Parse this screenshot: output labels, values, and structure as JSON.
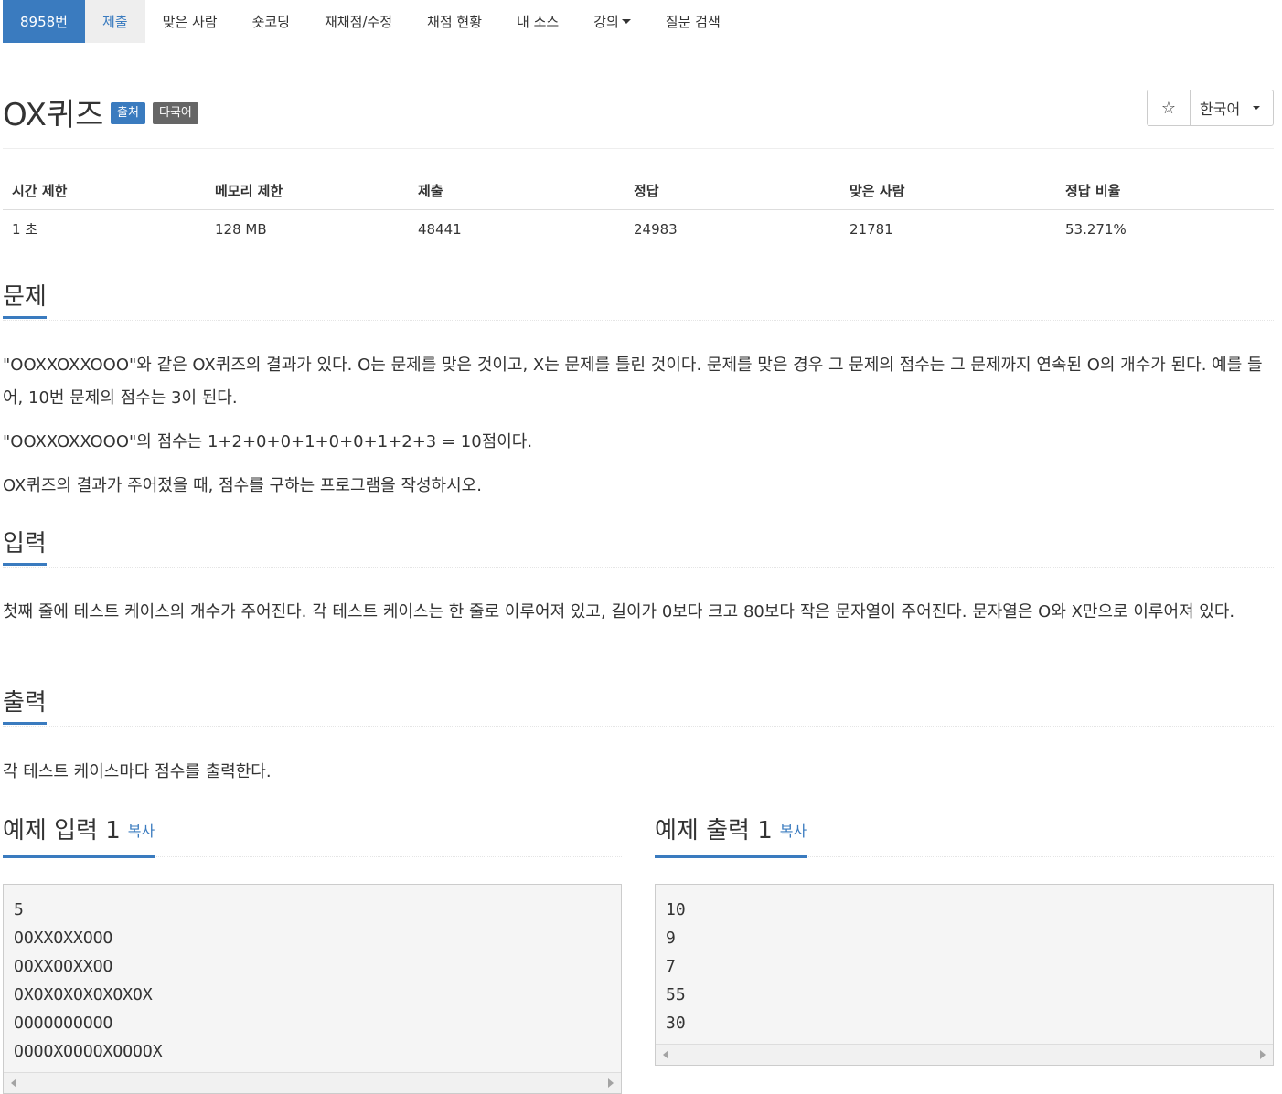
{
  "nav": {
    "items": [
      {
        "label": "8958번"
      },
      {
        "label": "제출"
      },
      {
        "label": "맞은 사람"
      },
      {
        "label": "숏코딩"
      },
      {
        "label": "재채점/수정"
      },
      {
        "label": "채점 현황"
      },
      {
        "label": "내 소스"
      },
      {
        "label": "강의"
      },
      {
        "label": "질문 검색"
      }
    ]
  },
  "problem": {
    "title": "OX퀴즈",
    "label_source": "출처",
    "label_multilang": "다국어",
    "star": "☆",
    "language": "한국어"
  },
  "stats": {
    "headers": [
      "시간 제한",
      "메모리 제한",
      "제출",
      "정답",
      "맞은 사람",
      "정답 비율"
    ],
    "values": [
      "1 초",
      "128 MB",
      "48441",
      "24983",
      "21781",
      "53.271%"
    ]
  },
  "description": {
    "heading": "문제",
    "p1": "\"OOXXOXXOOO\"와 같은 OX퀴즈의 결과가 있다. O는 문제를 맞은 것이고, X는 문제를 틀린 것이다. 문제를 맞은 경우 그 문제의 점수는 그 문제까지 연속된 O의 개수가 된다. 예를 들어, 10번 문제의 점수는 3이 된다.",
    "p2": "\"OOXXOXXOOO\"의 점수는 1+2+0+0+1+0+0+1+2+3 = 10점이다.",
    "p3": "OX퀴즈의 결과가 주어졌을 때, 점수를 구하는 프로그램을 작성하시오."
  },
  "input": {
    "heading": "입력",
    "text": "첫째 줄에 테스트 케이스의 개수가 주어진다. 각 테스트 케이스는 한 줄로 이루어져 있고, 길이가 0보다 크고 80보다 작은 문자열이 주어진다. 문자열은 O와 X만으로 이루어져 있다."
  },
  "output": {
    "heading": "출력",
    "text": "각 테스트 케이스마다 점수를 출력한다."
  },
  "sample_input": {
    "heading": "예제 입력 1",
    "copy": "복사",
    "lines": [
      "5",
      "OOXXOXXOOO",
      "OOXXOOXXOO",
      "OXOXOXOXOXOXOX",
      "OOOOOOOOOO",
      "OOOOXOOOOXOOOOX"
    ]
  },
  "sample_output": {
    "heading": "예제 출력 1",
    "copy": "복사",
    "lines": [
      "10",
      "9",
      "7",
      "55",
      "30"
    ]
  }
}
